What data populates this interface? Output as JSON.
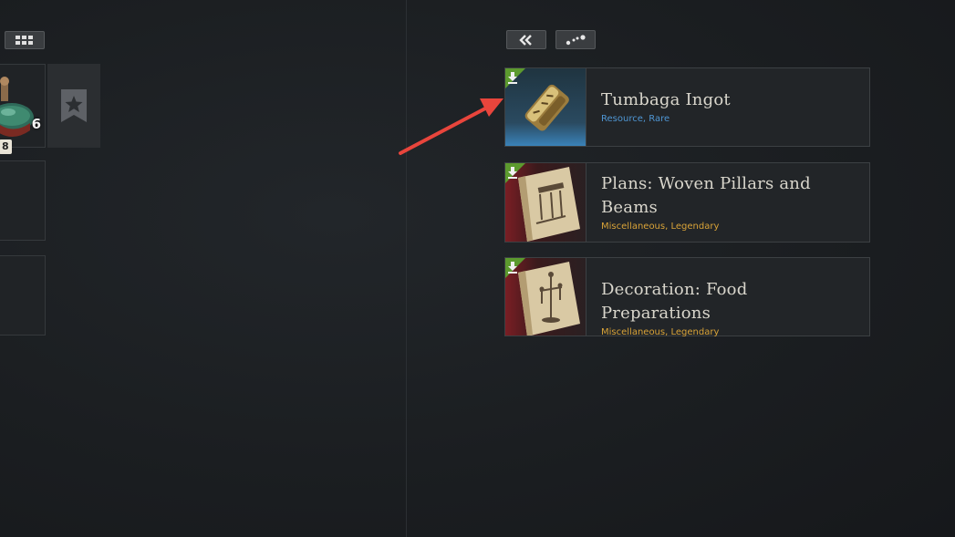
{
  "toolbar": {
    "left_grid_icon": "grid-view-icon",
    "collapse_icon": "double-chevron-left-icon",
    "dots_icon": "scatter-dots-icon"
  },
  "left_panel": {
    "item_quantity": "6",
    "item_badge": "8",
    "favorite_icon": "star-bookmark-icon"
  },
  "items": [
    {
      "name": "Tumbaga Ingot",
      "subtitle": "Resource, Rare",
      "rarity_color": "#4f96d3",
      "corner_color": "#5c9a2e"
    },
    {
      "name": "Plans: Woven Pillars and Beams",
      "subtitle": "Miscellaneous, Legendary",
      "rarity_color": "#d9a338",
      "corner_color": "#5c9a2e"
    },
    {
      "name": "Decoration: Food Preparations",
      "subtitle": "Miscellaneous, Legendary",
      "rarity_color": "#d9a338",
      "corner_color": "#5c9a2e"
    }
  ],
  "annotation": {
    "arrow_color": "#e8453c"
  }
}
